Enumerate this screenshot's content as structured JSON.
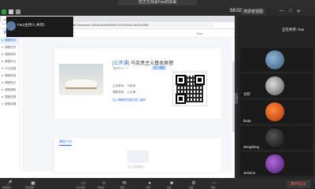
{
  "banner": {
    "text": "您正在观看Fan的屏幕"
  },
  "status": {
    "timer": "58:02",
    "view_button": "演讲者视图"
  },
  "browser": {
    "tab_title": "ciass201",
    "tab2_title": "class201",
    "url": "class201.ifclass.com/course/detail?id=2847&courseId=1563a2b5c9fd30fe5c7e02f7bfa3c1dbf20cc6f82"
  },
  "app": {
    "logo": "iClass",
    "course_title": "马克思主义基本原理",
    "user": "Sun"
  },
  "sidebar": {
    "items": [
      "课程首页",
      "课程任务",
      "课程资料",
      "课程作业",
      "讨论答疑",
      "课程测验",
      "课程笔记",
      "课程通知",
      "课程成绩",
      "课程设置"
    ]
  },
  "card": {
    "tag": "[公开课]",
    "title": "马克思主义基本原理",
    "sub": "课程学分：0",
    "enroll_button": "加入课程",
    "teacher": "主讲老师：  马老师",
    "type": "课程类型：  公共课",
    "link": "加入课程请扫描右侧二维码"
  },
  "panel": {
    "tab": "课程介绍",
    "empty": "暂无课程简介"
  },
  "participants": {
    "host_label": "Fan(主持人,共享)",
    "presenter": "正在共享: Fan",
    "names": [
      "",
      "文轩",
      "linda",
      "dengdeng",
      "Jessica",
      ""
    ]
  },
  "toolbar": {
    "labels": [
      "解除静音",
      "开启视频",
      "共享屏幕",
      "参会者",
      "聊天",
      "录制",
      "反应",
      "设置",
      "更多"
    ]
  },
  "leave_label": "离开会议",
  "colors": {
    "accent": "#2b6ae8",
    "leave": "#ff5a4e"
  }
}
